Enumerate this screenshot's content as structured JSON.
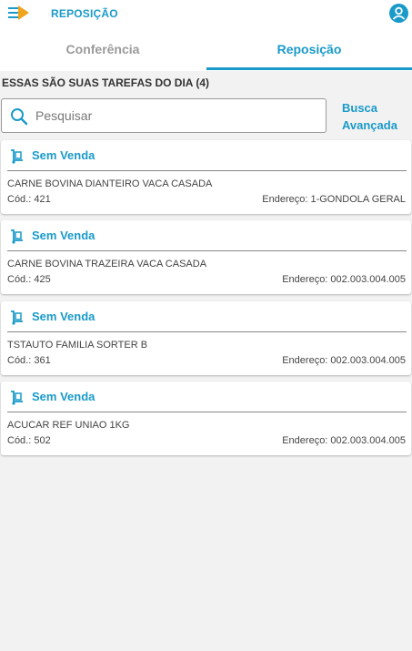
{
  "header": {
    "title": "REPOSIÇÃO",
    "menu_icon": "menu-arrow-icon",
    "profile_icon": "user-avatar-icon"
  },
  "tabs": [
    {
      "label": "Conferência",
      "active": false
    },
    {
      "label": "Reposição",
      "active": true
    }
  ],
  "section": {
    "title": "ESSAS SÃO SUAS TAREFAS DO DIA (4)"
  },
  "search": {
    "placeholder": "Pesquisar",
    "value": "",
    "advanced_line1": "Busca",
    "advanced_line2": "Avançada"
  },
  "tasks": [
    {
      "status": "Sem Venda",
      "name": "CARNE BOVINA DIANTEIRO VACA CASADA",
      "code": "Cód.: 421",
      "address": "Endereço: 1-GONDOLA GERAL"
    },
    {
      "status": "Sem Venda",
      "name": "CARNE BOVINA TRAZEIRA VACA CASADA",
      "code": "Cód.: 425",
      "address": "Endereço: 002.003.004.005"
    },
    {
      "status": "Sem Venda",
      "name": "TSTAUTO FAMILIA SORTER B",
      "code": "Cód.: 361",
      "address": "Endereço: 002.003.004.005"
    },
    {
      "status": "Sem Venda",
      "name": "ACUCAR REF UNIAO 1KG",
      "code": "Cód.: 502",
      "address": "Endereço: 002.003.004.005"
    }
  ],
  "colors": {
    "accent": "#1a9ac9",
    "menu_arrow": "#f0a31c",
    "background": "#f2f2f2"
  }
}
